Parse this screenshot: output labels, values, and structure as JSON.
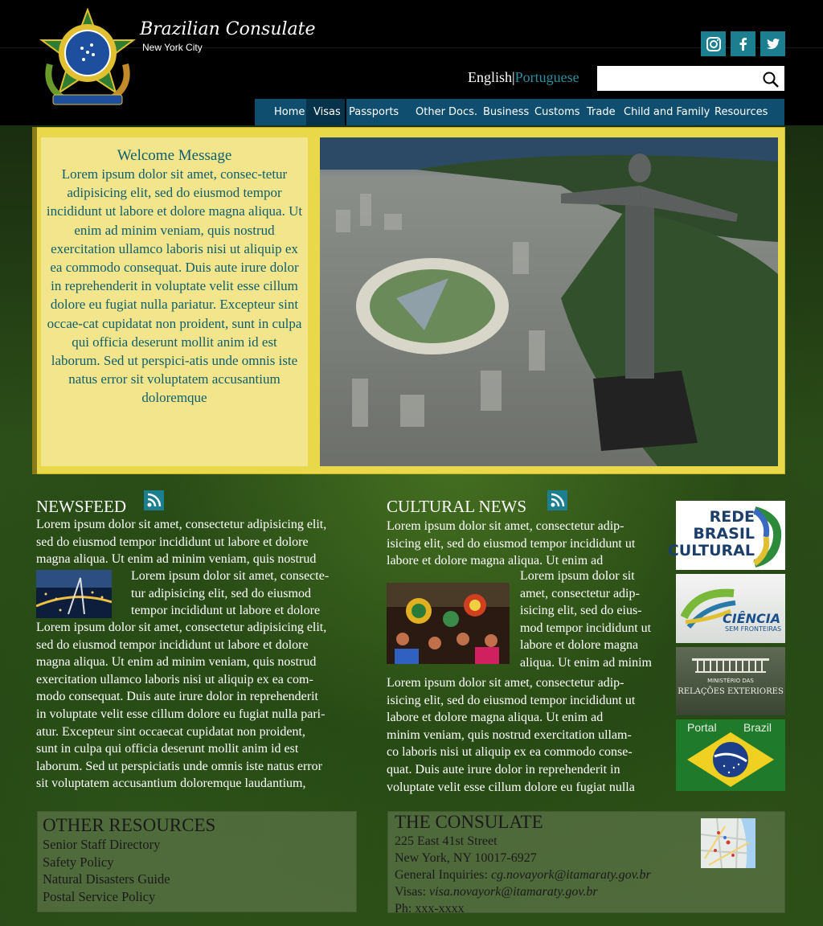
{
  "header": {
    "title": "Brazilian Consulate",
    "subtitle": "New York City",
    "language": {
      "english": "English",
      "separator": "|",
      "portuguese": "Portuguese"
    },
    "search": {
      "placeholder": ""
    },
    "social": [
      "instagram-icon",
      "facebook-icon",
      "twitter-icon"
    ]
  },
  "nav": {
    "items": [
      "Home",
      "Visas",
      "Passports",
      "Other Docs.",
      "Business",
      "Customs",
      "Trade",
      "Child and Family",
      "Resources"
    ],
    "active": "Visas"
  },
  "welcome": {
    "title": "Welcome Message",
    "text": "Lorem ipsum dolor sit amet, consec-tetur adipisicing elit, sed do eiusmod tempor incididunt ut labore et dolore magna aliqua. Ut enim ad minim veniam, quis nostrud exercitation ullamco laboris nisi ut aliquip ex ea commodo consequat. Duis aute irure dolor in reprehenderit in voluptate velit esse cillum dolore eu fugiat nulla pariatur. Excepteur sint occae-cat cupidatat non proident, sunt in culpa qui officia deserunt mollit anim id est laborum. Sed ut perspici-atis unde omnis iste natus error sit voluptatem accusantium doloremque"
  },
  "newsfeed": {
    "title": "NEWSFEED",
    "lines_top": [
      "Lorem ipsum dolor sit amet, consectetur adipisicing elit,",
      "sed do eiusmod tempor incididunt ut labore et dolore",
      "magna aliqua. Ut enim ad minim veniam, quis nostrud"
    ],
    "lines_side": [
      "Lorem ipsum dolor sit amet, consecte-",
      "tur adipisicing elit, sed do eiusmod",
      "tempor incididunt ut labore et dolore"
    ],
    "lines_bottom": [
      "Lorem ipsum dolor sit amet, consectetur adipisicing elit,",
      "sed do eiusmod tempor incididunt ut labore et dolore",
      "magna aliqua. Ut enim ad minim veniam, quis nostrud",
      "exercitation ullamco laboris nisi ut aliquip ex ea com-",
      "modo consequat. Duis aute irure dolor in reprehenderit",
      "in voluptate velit esse cillum dolore eu fugiat nulla pari-",
      "atur. Excepteur sint occaecat cupidatat non proident,",
      "sunt in culpa qui officia deserunt mollit anim id est",
      "laborum. Sed ut perspiciatis unde omnis iste natus error",
      "sit voluptatem accusantium doloremque laudantium,"
    ]
  },
  "cultural": {
    "title": "CULTURAL NEWS",
    "lines_top": [
      "Lorem ipsum dolor sit amet, consectetur adip-",
      "isicing elit, sed do eiusmod tempor incididunt ut",
      "labore et dolore magna aliqua. Ut enim ad"
    ],
    "lines_side": [
      "Lorem ipsum dolor sit",
      "amet, consectetur adip-",
      "isicing elit, sed do eius-",
      "mod tempor incididunt ut",
      "labore et dolore magna",
      "aliqua. Ut enim ad minim"
    ],
    "lines_bottom": [
      "Lorem ipsum dolor sit amet, consectetur adip-",
      "isicing elit, sed do eiusmod tempor incididunt ut",
      "labore et dolore magna aliqua. Ut enim ad",
      "minim veniam, quis nostrud exercitation ullam-",
      "co laboris nisi ut aliquip ex ea commodo conse-",
      "quat. Duis aute irure dolor in reprehenderit in",
      "voluptate velit esse cillum dolore eu fugiat nulla"
    ]
  },
  "partners": {
    "rede": [
      "REDE",
      "BRASIL",
      "CULTURAL"
    ],
    "ciencia": [
      "CIÊNCIA",
      "SEM FRONTEIRAS"
    ],
    "ministerio": [
      "MINISTÉRIO DAS",
      "RELAÇÕES EXTERIORES"
    ],
    "portal": [
      "Portal",
      "Brazil"
    ]
  },
  "resources": {
    "title": "OTHER RESOURCES",
    "links": [
      "Senior Staff Directory",
      "Safety Policy",
      "Natural Disasters Guide",
      "Postal Service Policy"
    ]
  },
  "consulate": {
    "title": "THE CONSULATE",
    "street": "225 East 41st Street",
    "city": "New York, NY 10017-6927",
    "general_label": "General Inquiries: ",
    "general_email": "cg.novayork@itamaraty.gov.br",
    "visas_label": "Visas: ",
    "visas_email": "visa.novayork@itamaraty.gov.br",
    "phone": "Ph: xxx-xxxx"
  },
  "colors": {
    "nav": "#0f4e6e",
    "accent_teal": "#1c7f8f",
    "hero_frame": "#e8d84a",
    "welcome_bg": "#f2e58c"
  }
}
